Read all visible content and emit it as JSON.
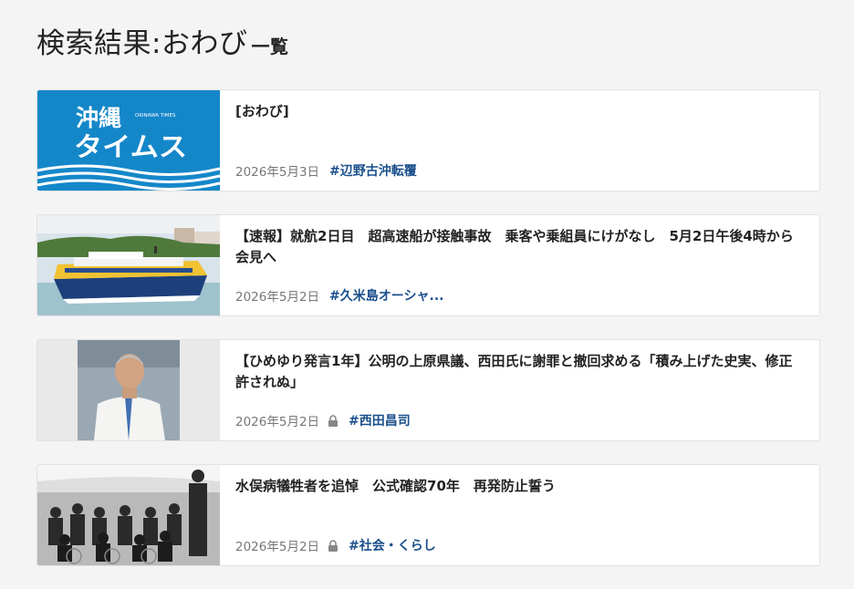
{
  "page": {
    "title": "検索結果:おわび",
    "title_suffix": "一覧"
  },
  "articles": [
    {
      "headline": "[おわび]",
      "date": "2026年5月3日",
      "tag": "#辺野古沖転覆",
      "locked": false,
      "thumbnail": {
        "logo_line1": "沖縄",
        "logo_small": "OKINAWA TIMES",
        "logo_line2": "タイムス"
      }
    },
    {
      "headline": "【速報】就航2日目　超高速船が接触事故　乗客や乗組員にけがなし　5月2日午後4時から会見へ",
      "date": "2026年5月2日",
      "tag": "#久米島オーシャ...",
      "locked": false
    },
    {
      "headline": "【ひめゆり発言1年】公明の上原県議、西田氏に謝罪と撤回求める「積み上げた史実、修正許されぬ」",
      "date": "2026年5月2日",
      "tag": "#西田昌司",
      "locked": true
    },
    {
      "headline": "水俣病犠牲者を追悼　公式確認70年　再発防止誓う",
      "date": "2026年5月2日",
      "tag": "#社会・くらし",
      "locked": true
    }
  ],
  "colors": {
    "background": "#f4f4f4",
    "card": "#ffffff",
    "tag": "#1a4f8b",
    "logo_blue": "#1487c9",
    "meta": "#777777"
  },
  "icons": {
    "lock": "lock-icon"
  }
}
